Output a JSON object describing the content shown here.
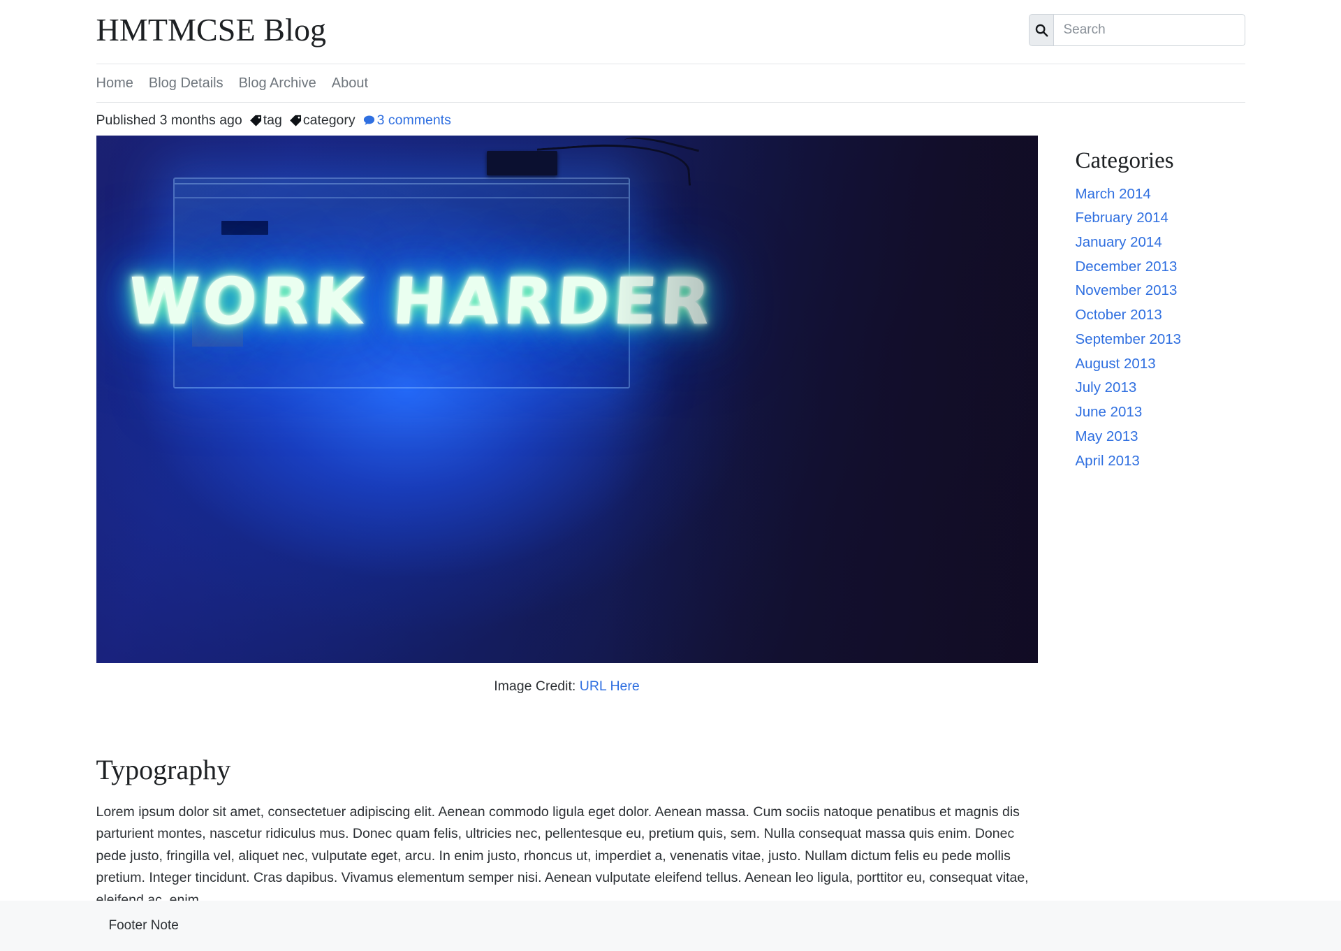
{
  "header": {
    "site_title": "HMTMCSE Blog",
    "search": {
      "icon": "search-icon",
      "placeholder": "Search",
      "value": ""
    }
  },
  "nav": {
    "items": [
      {
        "label": "Home"
      },
      {
        "label": "Blog Details"
      },
      {
        "label": "Blog Archive"
      },
      {
        "label": "About"
      }
    ]
  },
  "post": {
    "published": "Published 3 months ago",
    "tag": {
      "icon": "tag-icon",
      "label": "tag"
    },
    "category": {
      "icon": "tag-icon",
      "label": "category"
    },
    "comments": {
      "icon": "comment-bubble-icon",
      "label": "3 comments"
    },
    "featured_image": {
      "alt": "Blue neon sign reading WORK HARDER on a dark blue wall",
      "neon_text": "WORK HARDER"
    },
    "image_credit_prefix": "Image Credit:",
    "image_credit_link": "URL Here"
  },
  "article": {
    "heading": "Typography",
    "paragraph": "Lorem ipsum dolor sit amet, consectetuer adipiscing elit. Aenean commodo ligula eget dolor. Aenean massa. Cum sociis natoque penatibus et magnis dis parturient montes, nascetur ridiculus mus. Donec quam felis, ultricies nec, pellentesque eu, pretium quis, sem. Nulla consequat massa quis enim. Donec pede justo, fringilla vel, aliquet nec, vulputate eget, arcu. In enim justo, rhoncus ut, imperdiet a, venenatis vitae, justo. Nullam dictum felis eu pede mollis pretium. Integer tincidunt. Cras dapibus. Vivamus elementum semper nisi. Aenean vulputate eleifend tellus. Aenean leo ligula, porttitor eu, consequat vitae, eleifend ac, enim."
  },
  "sidebar": {
    "title": "Categories",
    "categories": [
      {
        "label": "March 2014"
      },
      {
        "label": "February 2014"
      },
      {
        "label": "January 2014"
      },
      {
        "label": "December 2013"
      },
      {
        "label": "November 2013"
      },
      {
        "label": "October 2013"
      },
      {
        "label": "September 2013"
      },
      {
        "label": "August 2013"
      },
      {
        "label": "July 2013"
      },
      {
        "label": "June 2013"
      },
      {
        "label": "May 2013"
      },
      {
        "label": "April 2013"
      }
    ]
  },
  "footer": {
    "note": "Footer Note"
  },
  "colors": {
    "link": "#2f6fe0",
    "text": "#2b2f33",
    "muted": "#6f767d",
    "border": "#e3e5e8",
    "footer_bg": "#f7f8f9"
  }
}
